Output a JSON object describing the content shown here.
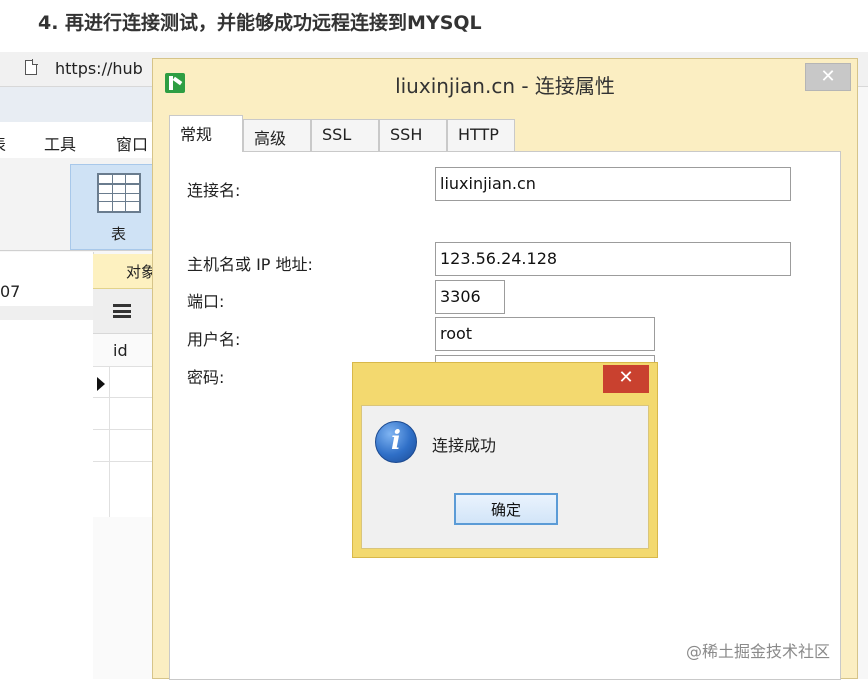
{
  "article": {
    "heading": "4. 再进行连接测试，并能够成功远程连接到MYSQL"
  },
  "background": {
    "url_text": "https://hub",
    "menu": [
      "表",
      "工具",
      "窗口"
    ],
    "toolbar_table_label": "表",
    "left_pane_value": "07",
    "object_tab_label": "对象",
    "grid_column": "id"
  },
  "dialog": {
    "title": "liuxinjian.cn - 连接属性",
    "close_glyph": "✕",
    "tabs": [
      "常规",
      "高级",
      "SSL",
      "SSH",
      "HTTP"
    ],
    "active_tab": "常规",
    "fields": {
      "connection_name": {
        "label": "连接名:",
        "value": "liuxinjian.cn"
      },
      "host": {
        "label": "主机名或 IP 地址:",
        "value": "123.56.24.128"
      },
      "port": {
        "label": "端口:",
        "value": "3306"
      },
      "username": {
        "label": "用户名:",
        "value": "root"
      },
      "password": {
        "label": "密码:",
        "value": ""
      }
    }
  },
  "message_box": {
    "close_glyph": "✕",
    "icon": "info-icon",
    "icon_glyph": "i",
    "text": "连接成功",
    "ok_label": "确定"
  },
  "watermark": "@稀土掘金技术社区",
  "colors": {
    "dialog_frame": "#fbeec2",
    "message_frame": "#f3d96f",
    "close_red": "#c9412f",
    "ok_border": "#5b9bd6",
    "table_button": "#cfe2f5"
  }
}
